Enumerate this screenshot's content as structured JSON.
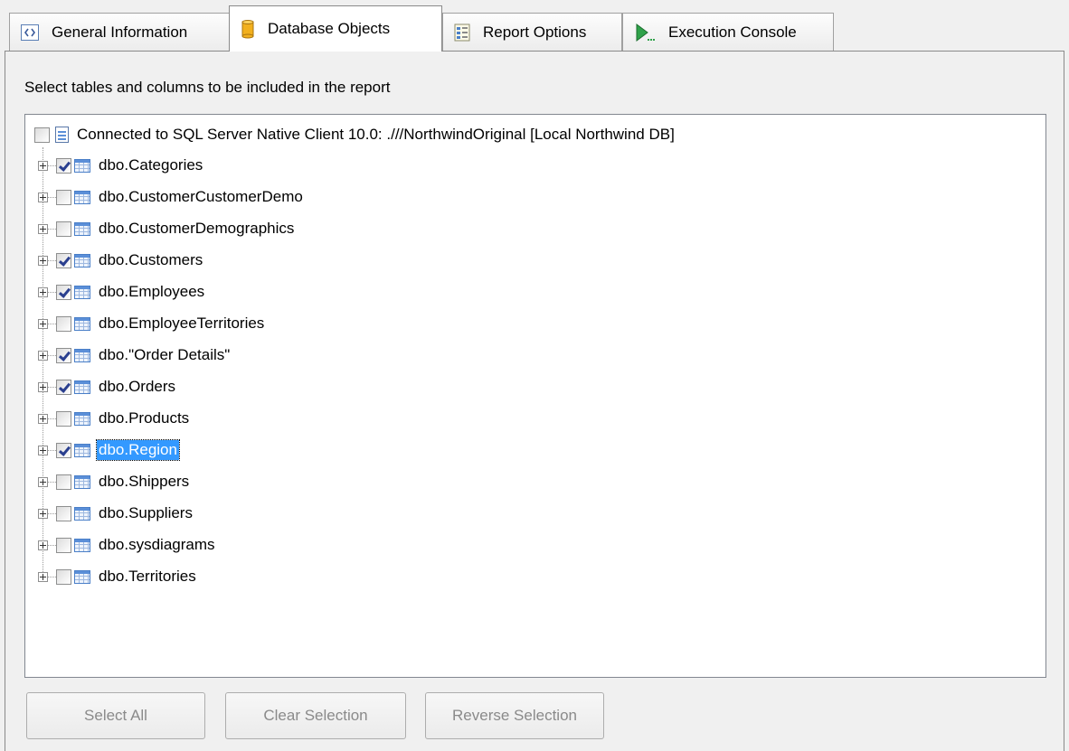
{
  "tabs": [
    {
      "label": "General Information",
      "icon": "code-brackets-icon",
      "active": false
    },
    {
      "label": "Database Objects",
      "icon": "database-cylinder-icon",
      "active": true
    },
    {
      "label": "Report Options",
      "icon": "report-options-icon",
      "active": false
    },
    {
      "label": "Execution Console",
      "icon": "console-run-icon",
      "active": false
    }
  ],
  "instruction": "Select tables and columns to be included in the report",
  "tree": {
    "root": {
      "label": "Connected to SQL Server Native Client 10.0: .///NorthwindOriginal [Local Northwind DB]",
      "checked": false
    },
    "items": [
      {
        "label": "dbo.Categories",
        "checked": true
      },
      {
        "label": "dbo.CustomerCustomerDemo",
        "checked": false
      },
      {
        "label": "dbo.CustomerDemographics",
        "checked": false
      },
      {
        "label": "dbo.Customers",
        "checked": true
      },
      {
        "label": "dbo.Employees",
        "checked": true
      },
      {
        "label": "dbo.EmployeeTerritories",
        "checked": false
      },
      {
        "label": "dbo.\"Order Details\"",
        "checked": true
      },
      {
        "label": "dbo.Orders",
        "checked": true
      },
      {
        "label": "dbo.Products",
        "checked": false
      },
      {
        "label": "dbo.Region",
        "checked": true,
        "selected": true
      },
      {
        "label": "dbo.Shippers",
        "checked": false
      },
      {
        "label": "dbo.Suppliers",
        "checked": false
      },
      {
        "label": "dbo.sysdiagrams",
        "checked": false
      },
      {
        "label": "dbo.Territories",
        "checked": false
      }
    ]
  },
  "buttons": {
    "select_all": "Select All",
    "clear_selection": "Clear Selection",
    "reverse_selection": "Reverse Selection"
  },
  "colors": {
    "selection": "#3399ff",
    "checkmark": "#2a3f8f",
    "table_icon": "#5b8fd8",
    "database_icon": "#f2b01e",
    "console_icon": "#2fa24a"
  }
}
